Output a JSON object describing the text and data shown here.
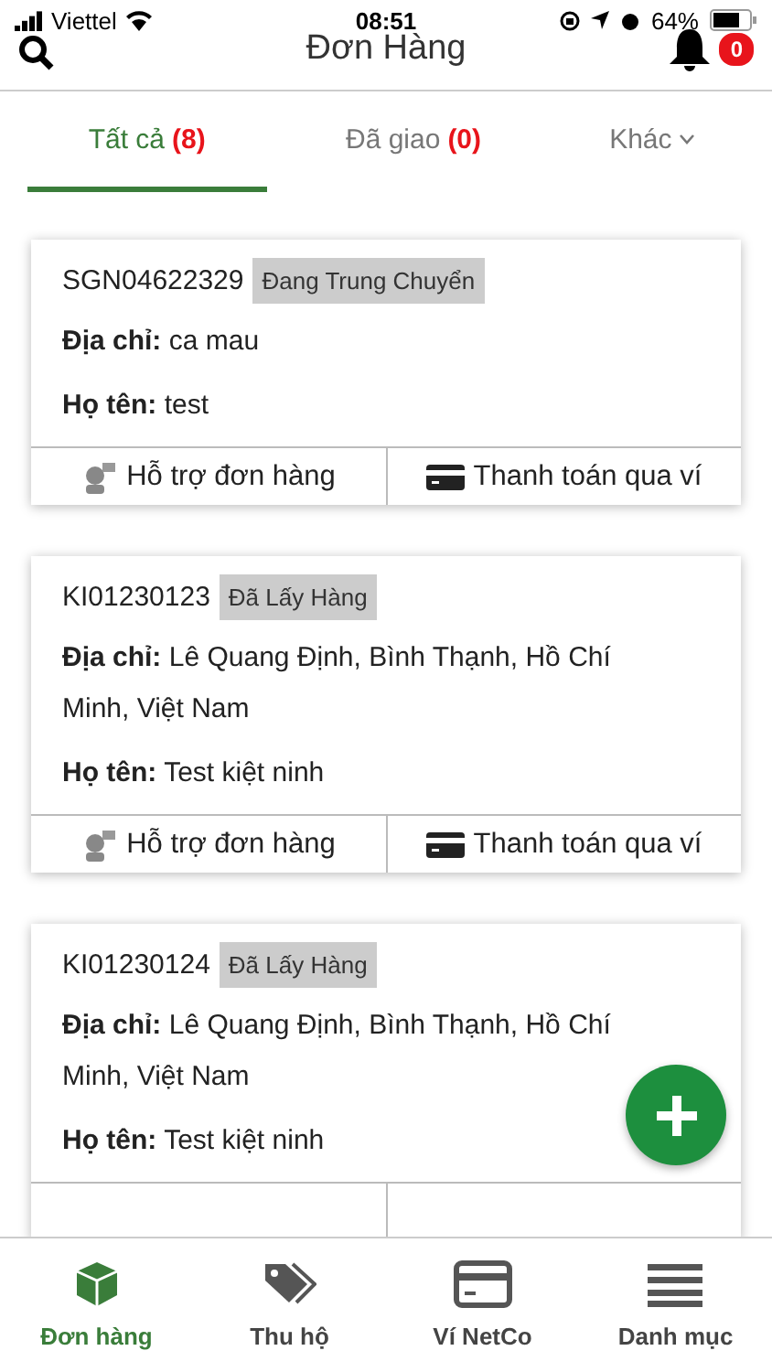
{
  "status_bar": {
    "carrier": "Viettel",
    "time": "08:51",
    "battery": "64%"
  },
  "header": {
    "title": "Đơn Hàng",
    "notification_count": "0"
  },
  "tabs": [
    {
      "label": "Tất cả",
      "count": "(8)",
      "kind": "count",
      "selected": true
    },
    {
      "label": "Đã giao",
      "count": "(0)",
      "kind": "count",
      "selected": false
    },
    {
      "label": "Khác",
      "kind": "menu",
      "selected": false
    }
  ],
  "orders": [
    {
      "code": "SGN04622329",
      "status": "Đang Trung Chuyển",
      "address_label": "Địa chỉ:",
      "address": "ca mau",
      "name_label": "Họ tên:",
      "name": "test",
      "actions": [
        "Hỗ trợ đơn hàng",
        "Thanh toán qua ví"
      ]
    },
    {
      "code": "KI01230123",
      "status": "Đã Lấy Hàng",
      "address_label": "Địa chỉ:",
      "address": "Lê Quang Định, Bình Thạnh, Hồ Chí Minh, Việt Nam",
      "name_label": "Họ tên:",
      "name": "Test kiệt ninh",
      "actions": [
        "Hỗ trợ đơn hàng",
        "Thanh toán qua ví"
      ]
    },
    {
      "code": "KI01230124",
      "status": "Đã Lấy Hàng",
      "address_label": "Địa chỉ:",
      "address": "Lê Quang Định, Bình Thạnh, Hồ Chí Minh, Việt Nam",
      "name_label": "Họ tên:",
      "name": "Test kiệt ninh"
    }
  ],
  "bottom_nav": [
    {
      "label": "Đơn hàng",
      "kind": "box",
      "selected": true
    },
    {
      "label": "Thu hộ",
      "kind": "tags",
      "selected": false
    },
    {
      "label": "Ví NetCo",
      "kind": "card",
      "selected": false
    },
    {
      "label": "Danh mục",
      "kind": "menu",
      "selected": false
    }
  ]
}
